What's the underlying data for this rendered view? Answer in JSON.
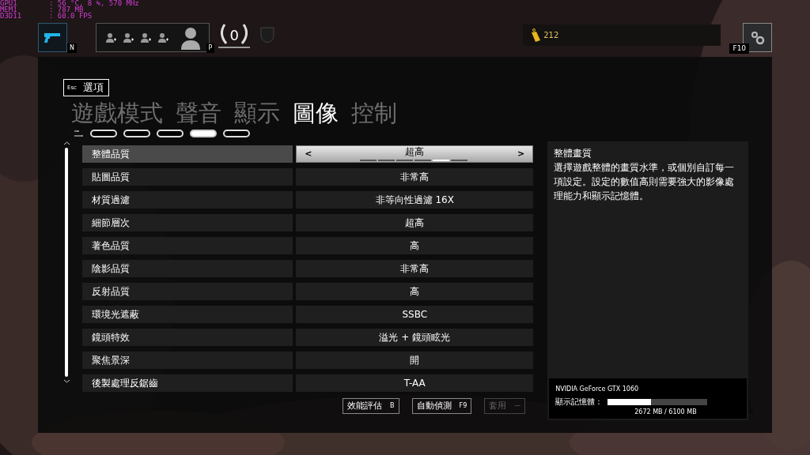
{
  "stats_overlay": [
    {
      "label": "GPU1",
      "value": ": 56 °C, 8 %, 570 MHz"
    },
    {
      "label": "MEM1",
      "value": ": 787 MB"
    },
    {
      "label": "D3D11",
      "value": ": 60.0 FPS"
    }
  ],
  "top_bar": {
    "weapon_key": "N",
    "squad_slots": [
      {
        "kind": "invite"
      },
      {
        "kind": "invite"
      },
      {
        "kind": "invite"
      },
      {
        "kind": "invite"
      }
    ],
    "profile_key": "P",
    "rank": "0",
    "currency": "212",
    "settings_key": "F10"
  },
  "back_button": {
    "key": "Esc",
    "label": "選項"
  },
  "tabs": [
    {
      "label": "遊戲模式",
      "selected": false
    },
    {
      "label": "聲音",
      "selected": false
    },
    {
      "label": "顯示",
      "selected": false
    },
    {
      "label": "圖像",
      "selected": true
    },
    {
      "label": "控制",
      "selected": false
    }
  ],
  "subtabs": [
    {
      "selected": false
    },
    {
      "selected": false
    },
    {
      "selected": false
    },
    {
      "selected": true
    },
    {
      "selected": false
    }
  ],
  "settings": [
    {
      "label": "整體品質",
      "value": "超高",
      "selected": true,
      "prev": "<",
      "next": ">",
      "steps": [
        {
          "selected": false
        },
        {
          "selected": false
        },
        {
          "selected": false
        },
        {
          "selected": false
        },
        {
          "selected": true
        },
        {
          "selected": false
        }
      ]
    },
    {
      "label": "貼圖品質",
      "value": "非常高",
      "selected": false
    },
    {
      "label": "材質過濾",
      "value": "非等向性過濾 16X",
      "selected": false
    },
    {
      "label": "細節層次",
      "value": "超高",
      "selected": false
    },
    {
      "label": "著色品質",
      "value": "高",
      "selected": false
    },
    {
      "label": "陰影品質",
      "value": "非常高",
      "selected": false
    },
    {
      "label": "反射品質",
      "value": "高",
      "selected": false
    },
    {
      "label": "環境光遮蔽",
      "value": "SSBC",
      "selected": false
    },
    {
      "label": "鏡頭特效",
      "value": "溢光 + 鏡頭眩光",
      "selected": false
    },
    {
      "label": "聚焦景深",
      "value": "開",
      "selected": false
    },
    {
      "label": "後製處理反鋸齒",
      "value": "T-AA",
      "selected": false
    }
  ],
  "description": {
    "title": "整體畫質",
    "body": "選擇遊戲整體的畫質水準，或個別自訂每一項設定。設定的數值高則需要強大的影像處理能力和顯示記憶體。"
  },
  "gpu": {
    "name": "NVIDIA GeForce GTX 1060",
    "memory_label": "顯示記憶體：",
    "level": 0.438,
    "reading": "2672 MB / 6100 MB"
  },
  "buttons": [
    {
      "label": "效能評估",
      "key": "B",
      "disabled": false
    },
    {
      "label": "自動偵測",
      "key": "F9",
      "disabled": false
    },
    {
      "label": "套用",
      "key": "—",
      "disabled": true
    }
  ]
}
